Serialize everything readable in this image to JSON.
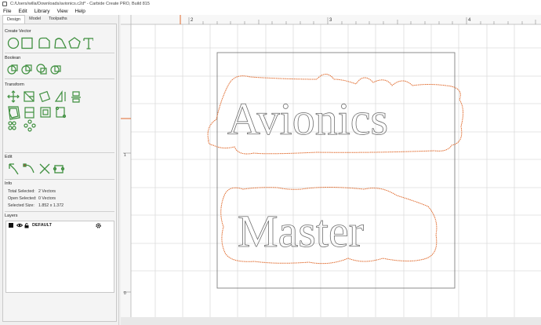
{
  "window": {
    "title": "C:/Users/willa/Downloads/avionics.c2d* - Carbide Create PRO, Build 815"
  },
  "menu": [
    "File",
    "Edit",
    "Library",
    "View",
    "Help"
  ],
  "tabs": [
    "Design",
    "Model",
    "Toolpaths"
  ],
  "sections": {
    "create_vector": "Create Vector",
    "boolean": "Boolean",
    "transform": "Transform",
    "edit": "Edit",
    "info": "Info",
    "layers": "Layers"
  },
  "info": {
    "total_selected_label": "Total Selected:",
    "total_selected_value": "2 Vectors",
    "open_selected_label": "Open Selected:",
    "open_selected_value": "0 Vectors",
    "selected_size_label": "Selected Size:",
    "selected_size_value": "1.852 x 1.372"
  },
  "layers": [
    {
      "name": "DEFAULT",
      "color": "#111111"
    }
  ],
  "ruler": {
    "h_labels": [
      "2",
      "3",
      "4"
    ],
    "v_labels": [
      "1",
      "0"
    ]
  },
  "canvas": {
    "line1": "Avionics",
    "line2": "Master"
  },
  "colors": {
    "accent_icon": "#3f8f3f",
    "toolpath": "#e06a2c",
    "outline": "#808080",
    "grid": "#dcdcdc"
  }
}
